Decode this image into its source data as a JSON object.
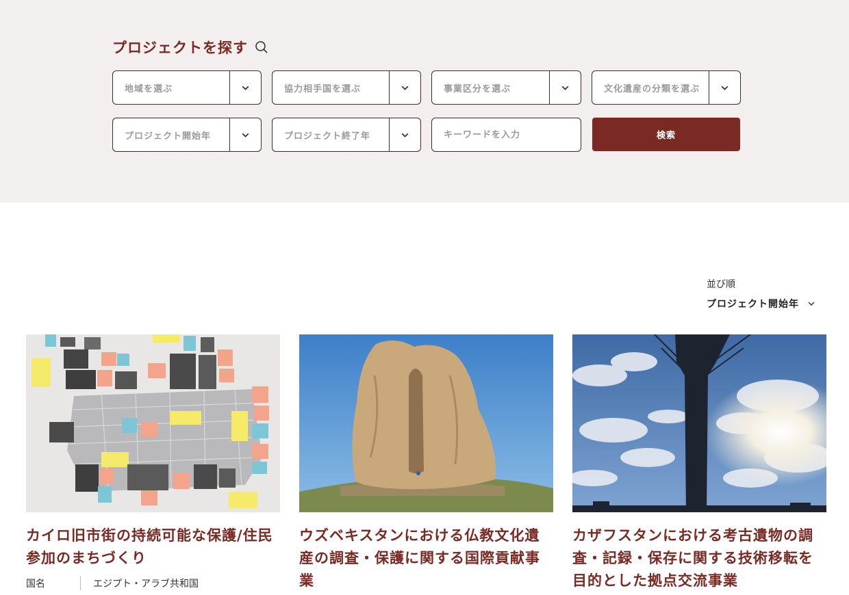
{
  "search": {
    "title": "プロジェクトを探す",
    "region": "地域を選ぶ",
    "partner_country": "協力相手国を選ぶ",
    "business_category": "事業区分を選ぶ",
    "heritage_category": "文化遺産の分類を選ぶ",
    "start_year": "プロジェクト開始年",
    "end_year": "プロジェクト終了年",
    "keyword_placeholder": "キーワードを入力",
    "submit": "検索"
  },
  "sort": {
    "label": "並び順",
    "selected": "プロジェクト開始年"
  },
  "cards": [
    {
      "title": "カイロ旧市街の持続可能な保護/住民参加のまちづくり",
      "meta_key": "国名",
      "meta_value": "エジプト・アラブ共和国"
    },
    {
      "title": "ウズベキスタンにおける仏教文化遺産の調査・保護に関する国際貢献事業"
    },
    {
      "title": "カザフスタンにおける考古遺物の調査・記録・保存に関する技術移転を目的とした拠点交流事業"
    }
  ],
  "colors": {
    "accent": "#7a2a22",
    "panel_bg": "#f3efee"
  }
}
